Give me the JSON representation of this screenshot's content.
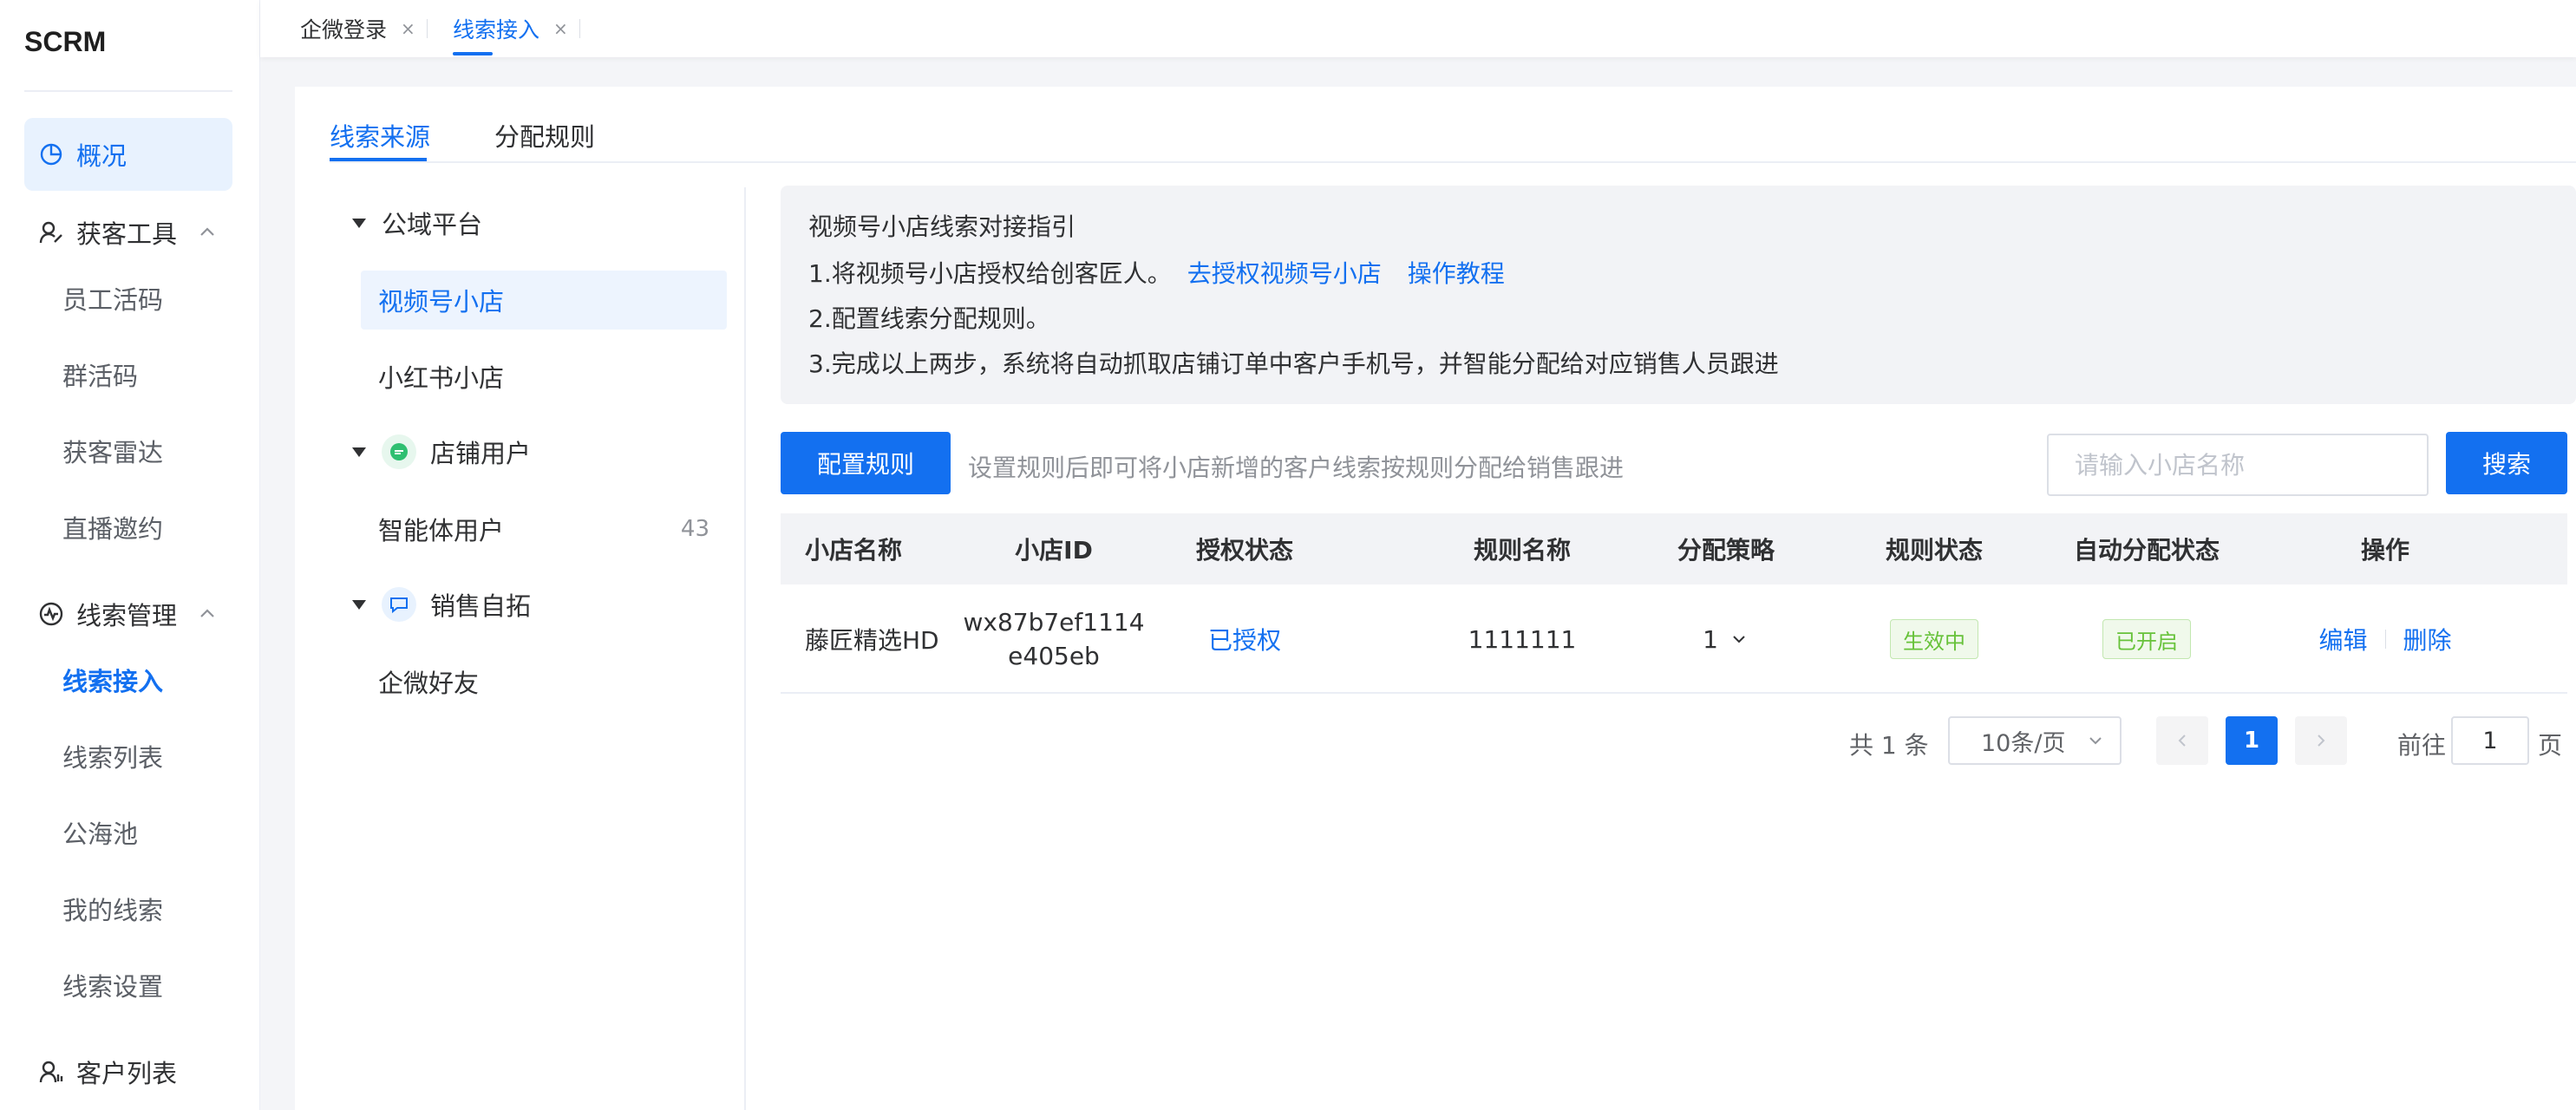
{
  "app": {
    "logo": "SCRM"
  },
  "sidebar": {
    "overview": "概况",
    "group1": {
      "title": "获客工具",
      "items": [
        "员工活码",
        "群活码",
        "获客雷达",
        "直播邀约"
      ]
    },
    "group2": {
      "title": "线索管理",
      "items": [
        "线索接入",
        "线索列表",
        "公海池",
        "我的线索",
        "线索设置"
      ]
    },
    "customer_list": "客户列表"
  },
  "topbar": {
    "tabs": [
      {
        "label": "企微登录",
        "close": "×"
      },
      {
        "label": "线索接入",
        "close": "×"
      }
    ]
  },
  "panel_tabs": [
    "线索来源",
    "分配规则"
  ],
  "tree": {
    "public": {
      "label": "公域平台",
      "children": [
        "视频号小店",
        "小红书小店"
      ]
    },
    "shop_users": {
      "label": "店铺用户",
      "child": {
        "label": "智能体用户",
        "count": "43"
      }
    },
    "sales": {
      "label": "销售自拓",
      "child": "企微好友"
    }
  },
  "guide": {
    "title": "视频号小店线索对接指引",
    "step1": "1.将视频号小店授权给创客匠人。",
    "link_auth": "去授权视频号小店",
    "link_tutorial": "操作教程",
    "step2": "2.配置线索分配规则。",
    "step3": "3.完成以上两步，系统将自动抓取店铺订单中客户手机号，并智能分配给对应销售人员跟进"
  },
  "toolbar": {
    "config_button": "配置规则",
    "hint": "设置规则后即可将小店新增的客户线索按规则分配给销售跟进",
    "search_placeholder": "请输入小店名称",
    "search_button": "搜索"
  },
  "table": {
    "headers": [
      "小店名称",
      "小店ID",
      "授权状态",
      "规则名称",
      "分配策略",
      "规则状态",
      "自动分配状态",
      "操作"
    ],
    "rows": [
      {
        "shop_name": "藤匠精选HD",
        "shop_id_line1": "wx87b7ef1114",
        "shop_id_line2": "e405eb",
        "auth_status": "已授权",
        "rule_name": "1111111",
        "strategy": "1",
        "rule_status": "生效中",
        "auto_status": "已开启",
        "action_edit": "编辑",
        "action_delete": "删除"
      }
    ]
  },
  "pagination": {
    "total": "共 1 条",
    "page_size": "10条/页",
    "current": "1",
    "goto_label": "前往",
    "goto_value": "1",
    "page_suffix": "页"
  },
  "colors": {
    "primary": "#1370f0",
    "success": "#67c23a"
  }
}
